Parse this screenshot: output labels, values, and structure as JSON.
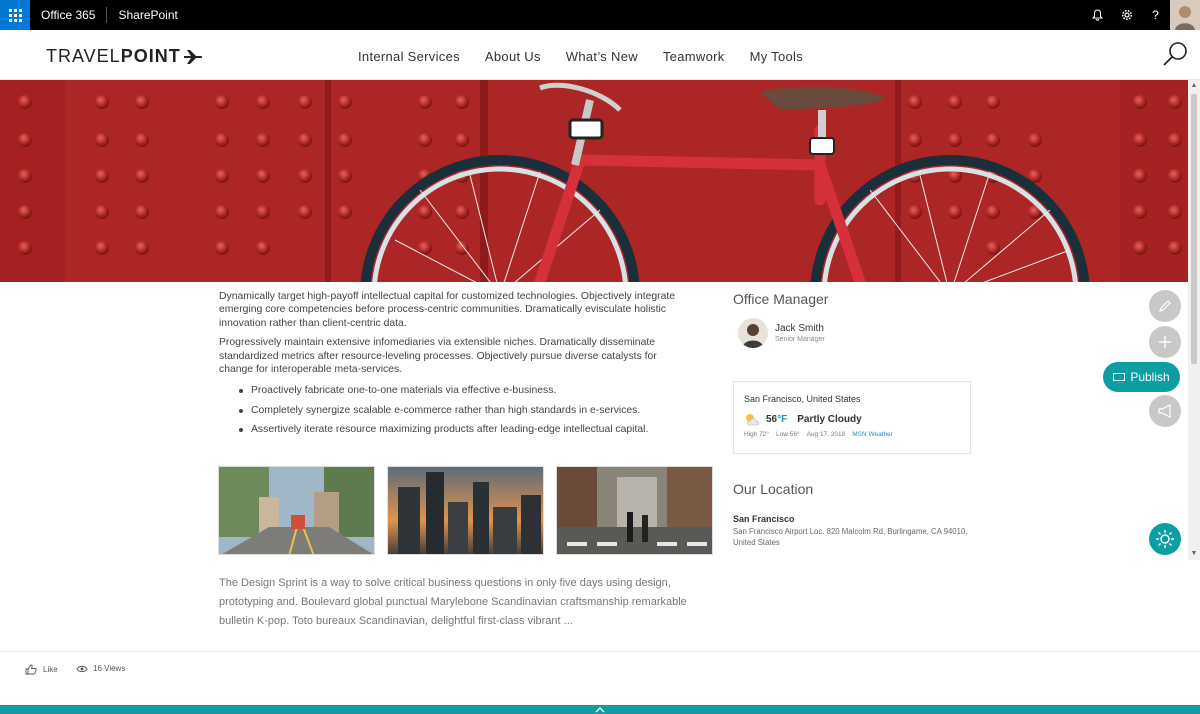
{
  "suite": {
    "app_name": "Office 365",
    "site_name": "SharePoint"
  },
  "header": {
    "logo_light": "TRAVEL",
    "logo_bold": "POINT",
    "nav": [
      {
        "label": "Internal Services"
      },
      {
        "label": "About Us"
      },
      {
        "label": "What’s New"
      },
      {
        "label": "Teamwork"
      },
      {
        "label": "My Tools"
      }
    ]
  },
  "article": {
    "p1": "Dynamically target high-payoff intellectual capital for customized technologies. Objectively integrate emerging core competencies before process-centric communities. Dramatically evisculate holistic innovation rather than client-centric data.",
    "p2": "Progressively maintain extensive infomediaries via extensible niches. Dramatically disseminate standardized metrics after resource-leveling processes. Objectively pursue diverse catalysts for change for interoperable meta-services.",
    "bullets": [
      "Proactively fabricate one-to-one materials via effective e-business.",
      "Completely synergize scalable e-commerce rather than high standards in e-services.",
      "Assertively iterate resource maximizing products after leading-edge intellectual capital."
    ],
    "teaser": "The Design Sprint is a way to solve critical business questions in only five days using design, prototyping and. Boulevard global punctual Marylebone Scandinavian craftsmanship remarkable bulletin K-pop. Toto bureaux Scandinavian, delightful first-class vibrant ..."
  },
  "office_manager": {
    "title": "Office Manager",
    "name": "Jack Smith",
    "role": "Senior Manager"
  },
  "weather": {
    "location": "San Francisco, United States",
    "temp": "56",
    "unit": "°F",
    "condition": "Partly Cloudy",
    "high": "High 72°",
    "low": "Low 56°",
    "date": "Aug 17, 2018",
    "source": "MSN Weather"
  },
  "location": {
    "title": "Our Location",
    "city": "San Francisco",
    "address": "San Francisco Airport Loc. 820 Malcolm Rd, Burlingame, CA 94010, United States"
  },
  "actions": {
    "publish_label": "Publish"
  },
  "footer": {
    "like_label": "Like",
    "views_label": "16 Views"
  },
  "colors": {
    "accent": "#0c9ea3",
    "hero_red": "#b12a2a",
    "suite_bar": "#000000",
    "waffle": "#0078d4"
  }
}
